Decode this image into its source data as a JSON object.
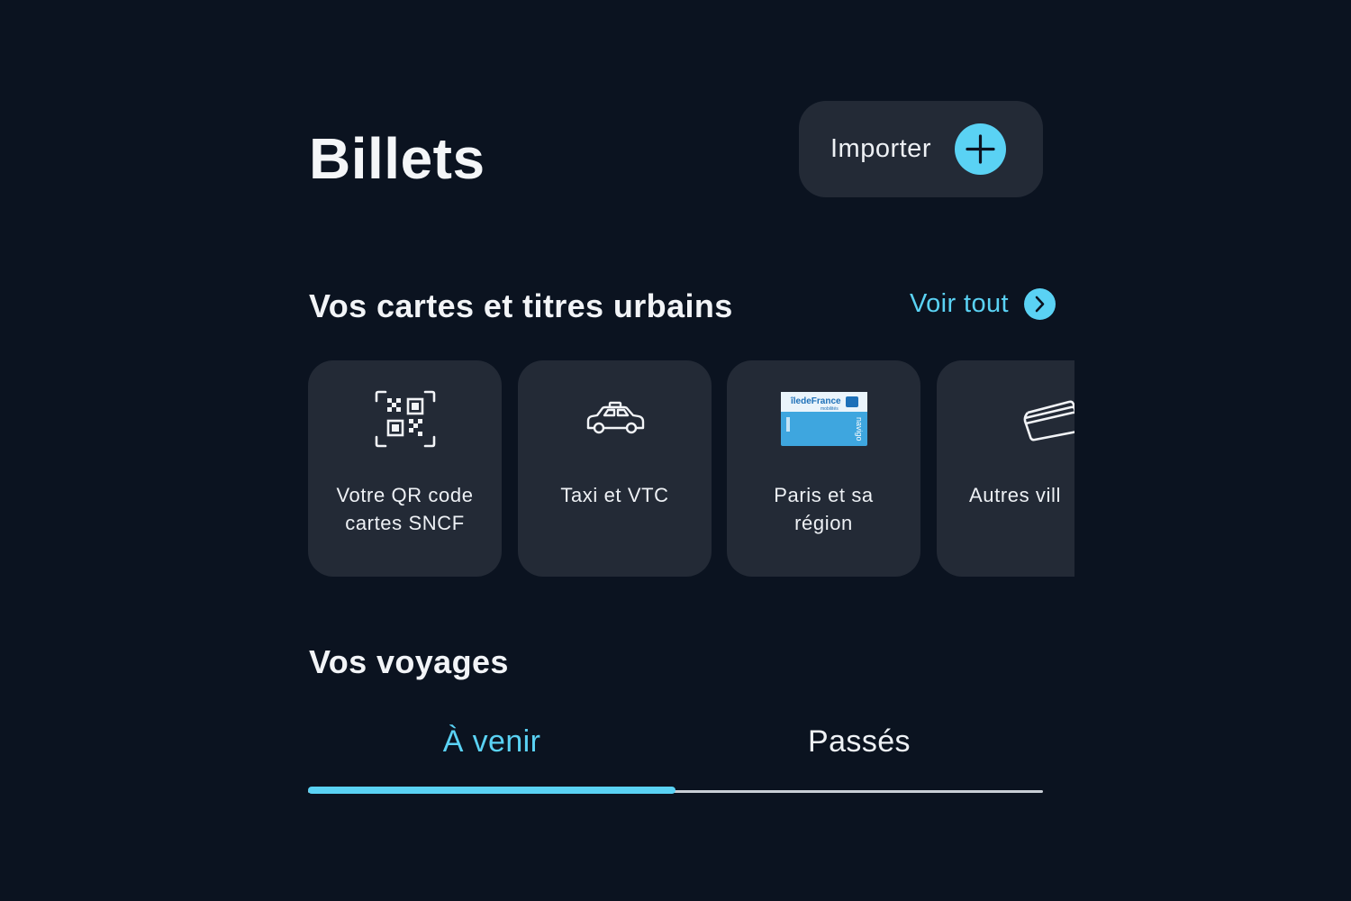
{
  "header": {
    "title": "Billets",
    "import_label": "Importer",
    "import_icon": "plus-icon"
  },
  "colors": {
    "accent": "#5ad2f4",
    "background": "#0b1320",
    "card": "#232a36",
    "text": "#f2f4f7"
  },
  "cards_section": {
    "title": "Vos cartes et titres urbains",
    "see_all_label": "Voir tout",
    "see_all_icon": "chevron-right-icon",
    "cards": [
      {
        "label": "Votre QR code\ncartes SNCF",
        "icon": "qr-code-icon"
      },
      {
        "label": "Taxi et VTC",
        "icon": "taxi-icon"
      },
      {
        "label": "Paris et sa\nrégion",
        "icon": "navigo-card-icon",
        "card_brand": "îledeFrance",
        "card_brand_sub": "mobilités",
        "card_name": "navigo"
      },
      {
        "label": "Autres vill",
        "icon": "tickets-icon"
      }
    ]
  },
  "trips_section": {
    "title": "Vos voyages",
    "tabs": [
      {
        "label": "À venir",
        "active": true
      },
      {
        "label": "Passés",
        "active": false
      }
    ]
  }
}
